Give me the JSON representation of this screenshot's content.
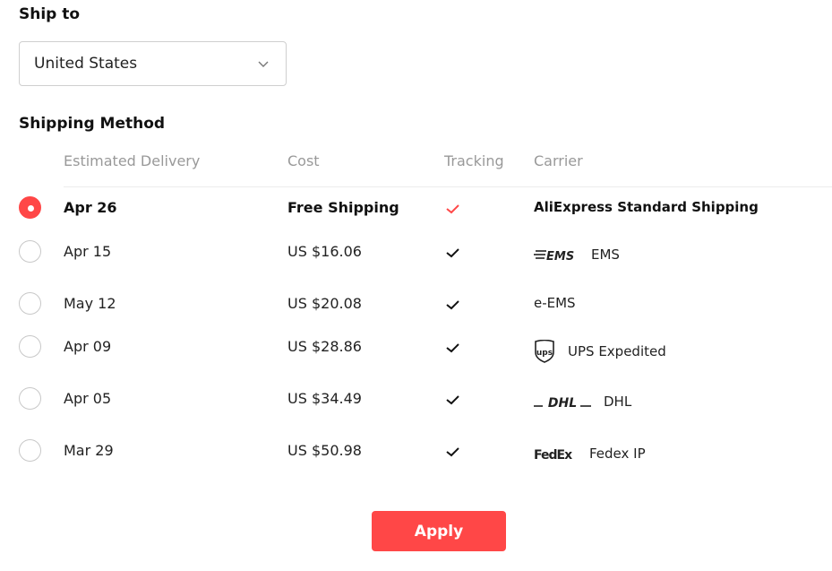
{
  "ship_to": {
    "title": "Ship to",
    "selected_country": "United States"
  },
  "shipping_method": {
    "title": "Shipping Method",
    "columns": {
      "delivery": "Estimated Delivery",
      "cost": "Cost",
      "tracking": "Tracking",
      "carrier": "Carrier"
    },
    "rows": [
      {
        "date": "Apr 26",
        "cost": "Free Shipping",
        "carrier": "AliExpress Standard Shipping",
        "selected": true
      },
      {
        "date": "Apr 15",
        "cost": "US $16.06",
        "carrier": "EMS",
        "logo_text": "EMS"
      },
      {
        "date": "May 12",
        "cost": "US $20.08",
        "carrier": "e-EMS"
      },
      {
        "date": "Apr 09",
        "cost": "US $28.86",
        "carrier": "UPS Expedited",
        "logo_text": "ups"
      },
      {
        "date": "Apr 05",
        "cost": "US $34.49",
        "carrier": "DHL",
        "logo_text": "DHL"
      },
      {
        "date": "Mar 29",
        "cost": "US $50.98",
        "carrier": "Fedex IP",
        "logo_text": "FedEx"
      }
    ]
  },
  "apply_label": "Apply",
  "colors": {
    "accent": "#ff4747",
    "muted_text": "#999999",
    "check": "#111111"
  }
}
